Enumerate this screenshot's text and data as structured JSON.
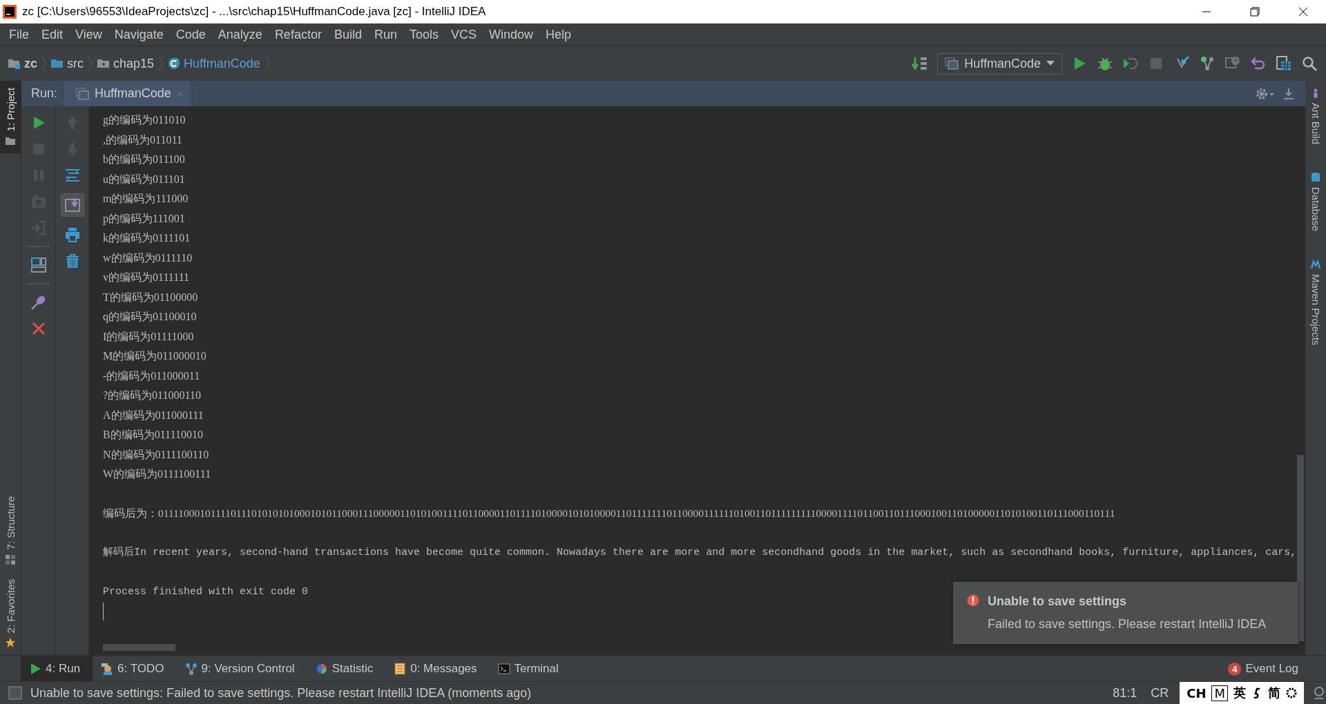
{
  "window": {
    "title": "zc [C:\\Users\\96553\\IdeaProjects\\zc] - ...\\src\\chap15\\HuffmanCode.java [zc] - IntelliJ IDEA"
  },
  "menu": [
    "File",
    "Edit",
    "View",
    "Navigate",
    "Code",
    "Analyze",
    "Refactor",
    "Build",
    "Run",
    "Tools",
    "VCS",
    "Window",
    "Help"
  ],
  "breadcrumbs": [
    {
      "label": "zc",
      "kind": "project"
    },
    {
      "label": "src",
      "kind": "folder"
    },
    {
      "label": "chap15",
      "kind": "package"
    },
    {
      "label": "HuffmanCode",
      "kind": "class"
    }
  ],
  "run_config": {
    "label": "HuffmanCode"
  },
  "left_stripe": [
    {
      "label": "1: Project",
      "selected": true
    },
    {
      "label": "7: Structure",
      "selected": false
    },
    {
      "label": "2: Favorites",
      "selected": false
    }
  ],
  "right_stripe": [
    {
      "label": "Ant Build"
    },
    {
      "label": "Database"
    },
    {
      "label": "Maven Projects"
    }
  ],
  "run_panel": {
    "title": "Run:",
    "tab": "HuffmanCode",
    "console": [
      "g的编码为011010",
      ",的编码为011011",
      "b的编码为011100",
      "u的编码为011101",
      "m的编码为111000",
      "p的编码为111001",
      "k的编码为0111101",
      "w的编码为0111110",
      "v的编码为0111111",
      "T的编码为01100000",
      "q的编码为01100010",
      "I的编码为01111000",
      "M的编码为011000010",
      "-的编码为011000011",
      "?的编码为011000110",
      "A的编码为011000111",
      "B的编码为011110010",
      "N的编码为0111100110",
      "W的编码为0111100111"
    ],
    "encoded": "编码后为：011110001011110111010101010001010110001110000011010100111101100001101111010000101010000110111111101100001111110100110111111111000011110110011011100010011010000011010100110111000110111",
    "decoded": "解码后In recent years, second-hand transactions have become quite common. Nowadays there are more and more secondhand goods in the market, such as secondhand books, furniture, appliances, cars,",
    "exit": "Process finished with exit code 0"
  },
  "notification": {
    "title": "Unable to save settings",
    "message": "Failed to save settings. Please restart IntelliJ IDEA"
  },
  "tool_tabs": [
    {
      "label": "4: Run",
      "kind": "run",
      "selected": true
    },
    {
      "label": "6: TODO",
      "kind": "todo",
      "selected": false
    },
    {
      "label": "9: Version Control",
      "kind": "vcs",
      "selected": false
    },
    {
      "label": "Statistic",
      "kind": "statistic",
      "selected": false
    },
    {
      "label": "0: Messages",
      "kind": "messages",
      "selected": false
    },
    {
      "label": "Terminal",
      "kind": "terminal",
      "selected": false
    }
  ],
  "event_log": {
    "count": "4",
    "label": "Event Log"
  },
  "status_bar": {
    "message": "Unable to save settings: Failed to save settings. Please restart IntelliJ IDEA (moments ago)",
    "position": "81:1",
    "line_separator": "CR"
  },
  "ime": [
    "CH",
    "M",
    "英",
    "简"
  ]
}
